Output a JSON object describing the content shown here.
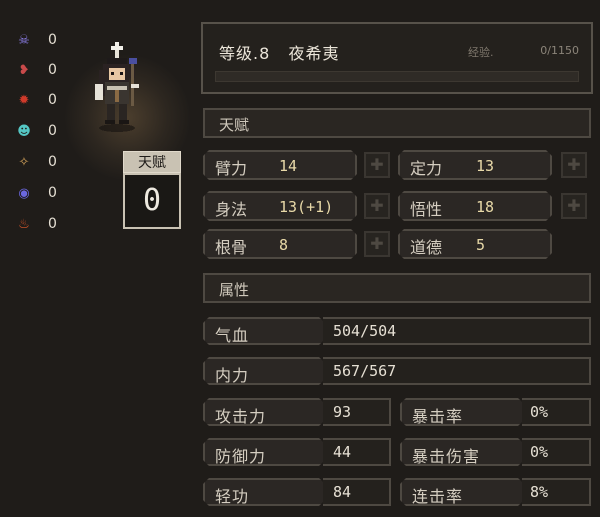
{
  "status_effects": [
    {
      "icon": "skull-icon",
      "glyph": "☠",
      "color": "#8c7ee8",
      "count": "0"
    },
    {
      "icon": "broken-heart-icon",
      "glyph": "❥",
      "color": "#c94a4a",
      "count": "0"
    },
    {
      "icon": "bleed-icon",
      "glyph": "✹",
      "color": "#d03a2a",
      "count": "0"
    },
    {
      "icon": "poison-skull-icon",
      "glyph": "☻",
      "color": "#55c7c4",
      "count": "0"
    },
    {
      "icon": "stun-icon",
      "glyph": "✧",
      "color": "#d4a35a",
      "count": "0"
    },
    {
      "icon": "confuse-icon",
      "glyph": "◉",
      "color": "#6b68e0",
      "count": "0"
    },
    {
      "icon": "burn-icon",
      "glyph": "♨",
      "color": "#e05a2a",
      "count": "0"
    }
  ],
  "talent_box": {
    "label": "天赋",
    "value": "0"
  },
  "header": {
    "level_text": "等级.8",
    "name": "夜希夷",
    "exp_label": "经验.",
    "exp_value": "0/1150",
    "exp_progress": 0
  },
  "talent_section": {
    "title": "天赋"
  },
  "talent_stats": [
    {
      "label": "臂力",
      "value": "14"
    },
    {
      "label": "定力",
      "value": "13"
    },
    {
      "label": "身法",
      "value": "13(+1)"
    },
    {
      "label": "悟性",
      "value": "18"
    },
    {
      "label": "根骨",
      "value": "8"
    },
    {
      "label": "道德",
      "value": "5"
    }
  ],
  "attribute_section": {
    "title": "属性"
  },
  "attributes_wide": [
    {
      "label": "气血",
      "value": "504/504"
    },
    {
      "label": "内力",
      "value": "567/567"
    }
  ],
  "attributes_grid": [
    {
      "label": "攻击力",
      "value": "93"
    },
    {
      "label": "暴击率",
      "value": "0%"
    },
    {
      "label": "防御力",
      "value": "44"
    },
    {
      "label": "暴击伤害",
      "value": "0%"
    },
    {
      "label": "轻功",
      "value": "84"
    },
    {
      "label": "连击率",
      "value": "8%"
    }
  ],
  "colors": {
    "stat_value": "#e8d9a8",
    "panel_border": "#4e4942",
    "background": "#1f1c19"
  }
}
